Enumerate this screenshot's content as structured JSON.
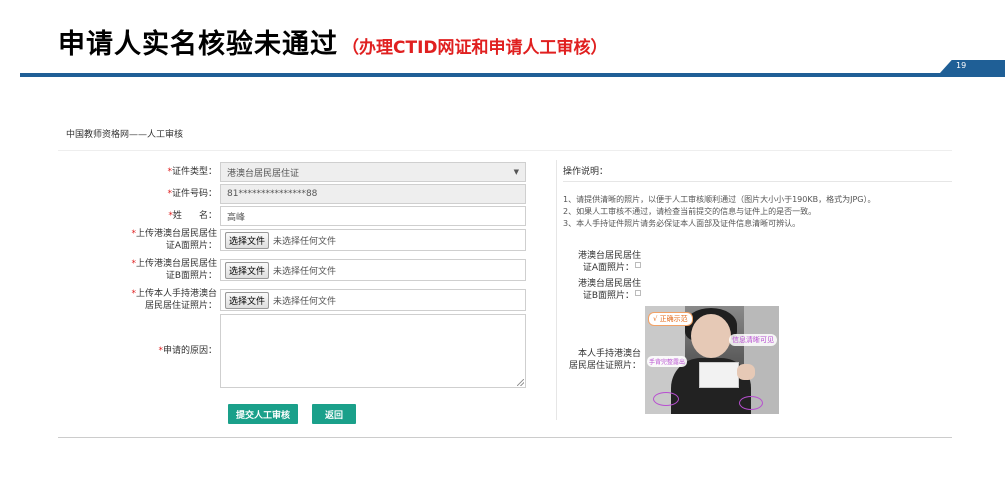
{
  "slide": {
    "title": "申请人实名核验未通过",
    "subtitle": "（办理CTID网证和申请人工审核）",
    "page_number": "19"
  },
  "form": {
    "header": "中国教师资格网——人工审核",
    "required_mark": "*",
    "fields": {
      "doc_type": {
        "label": "证件类型：",
        "value": "港澳台居民居住证",
        "caret": "▼"
      },
      "doc_number": {
        "label": "证件号码：",
        "value": "81***************88"
      },
      "name": {
        "label": "姓      名：",
        "value": "高峰"
      },
      "upload_a": {
        "label_line1": "上传港澳台居民居住",
        "label_line2": "证A面照片：",
        "button": "选择文件",
        "status": "未选择任何文件"
      },
      "upload_b": {
        "label_line1": "上传港澳台居民居住",
        "label_line2": "证B面照片：",
        "button": "选择文件",
        "status": "未选择任何文件"
      },
      "upload_self": {
        "label_line1": "上传本人手持港澳台",
        "label_line2": "居民居住证照片：",
        "button": "选择文件",
        "status": "未选择任何文件"
      },
      "reason": {
        "label": "申请的原因：",
        "value": ""
      }
    },
    "buttons": {
      "submit": "提交人工审核",
      "back": "返回"
    }
  },
  "instructions": {
    "title": "操作说明：",
    "notes": [
      "1、请提供清晰的照片，以便于人工审核顺利通过（图片大小小于190KB，格式为JPG）。",
      "2、如果人工审核不通过，请检查当前提交的信息与证件上的是否一致。",
      "3、本人手持证件照片请务必保证本人面部及证件信息清晰可辨认。"
    ],
    "samples": {
      "front": {
        "line1": "港澳台居民居住",
        "line2": "证A面照片："
      },
      "back": {
        "line1": "港澳台居民居住",
        "line2": "证B面照片："
      },
      "handheld": {
        "line1": "本人手持港澳台",
        "line2": "居民居住证照片："
      }
    },
    "photo_tags": {
      "correct": "√ 正确示范",
      "info": "信息清晰可见",
      "hand": "手背完整露出"
    }
  },
  "colors": {
    "accent_blue": "#1f5f96",
    "button_green": "#1aa08a",
    "title_red": "#e02020",
    "required_red": "#e02020"
  }
}
